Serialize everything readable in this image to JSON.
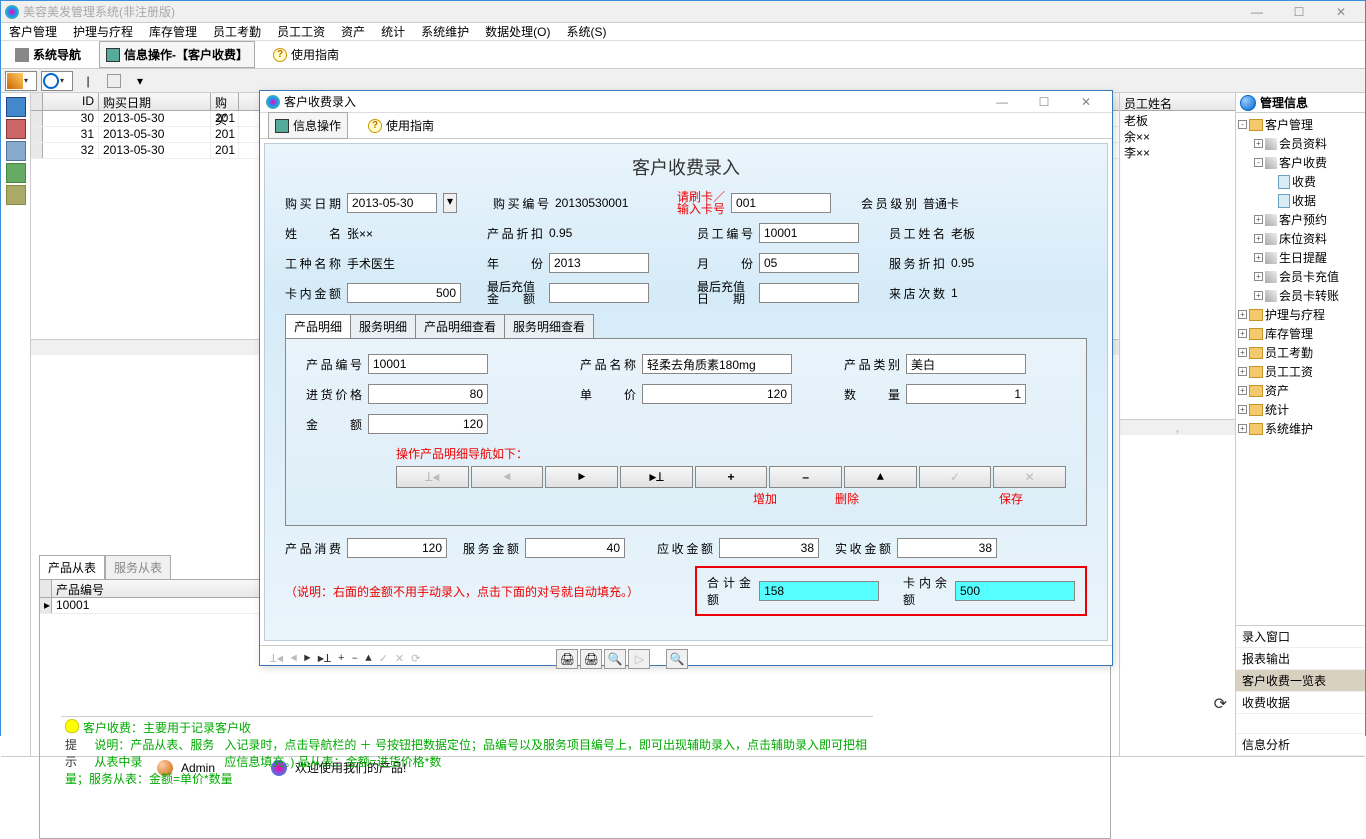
{
  "app": {
    "title": "美容美发管理系统(非注册版)"
  },
  "menu": [
    "客户管理",
    "护理与疗程",
    "库存管理",
    "员工考勤",
    "员工工资",
    "资产",
    "统计",
    "系统维护",
    "数据处理(O)",
    "系统(S)"
  ],
  "topTabs": {
    "nav": "系统导航",
    "info": "信息操作-【客户收费】",
    "guide": "使用指南"
  },
  "grid": {
    "cols": [
      "ID",
      "购买日期",
      "购买"
    ],
    "rows": [
      {
        "id": "30",
        "date": "2013-05-30",
        "t": "201"
      },
      {
        "id": "31",
        "date": "2013-05-30",
        "t": "201"
      },
      {
        "id": "32",
        "date": "2013-05-30",
        "t": "201"
      }
    ]
  },
  "subTabs": {
    "a": "产品从表",
    "b": "服务从表"
  },
  "subGrid": {
    "col": "产品编号",
    "val": "10001"
  },
  "rightList": {
    "header": "员工姓名",
    "rows": [
      "老板",
      "余××",
      "李××"
    ]
  },
  "tree": {
    "header": "管理信息",
    "root": "客户管理",
    "items": [
      "会员资料",
      "客户收费",
      "收费",
      "收据",
      "客户预约",
      "床位资料",
      "生日提醒",
      "会员卡充值",
      "会员卡转账"
    ],
    "folders": [
      "护理与疗程",
      "库存管理",
      "员工考勤",
      "员工工资",
      "资产",
      "统计",
      "系统维护"
    ],
    "bottom": [
      "录入窗口",
      "报表输出",
      "客户收费一览表",
      "收费收据",
      "信息分析"
    ]
  },
  "help": {
    "l1": "客户收费：主要用于记录客户收",
    "l2pre": "说明：产品从表、服务从表中录",
    "l2rest": "入记录时，点击导航栏的 ＋ 号按钮把数据定位；品编号以及服务项目编号上，即可出现辅助录入，点击辅助录入即可把相应信息填充。)   品从表：金额=进货价格*数",
    "l3": "量；服务从表：金额=单价*数量",
    "hint": "提示"
  },
  "status": {
    "admin": "Admin",
    "welcome": "欢迎使用我们的产品!"
  },
  "modal": {
    "title": "客户收费录入",
    "tabs": {
      "info": "信息操作",
      "guide": "使用指南"
    },
    "heading": "客户收费录入",
    "labels": {
      "buyDate": "购买日期",
      "buyNo": "购买编号",
      "swipe": "请刷卡／",
      "enterCard": "输入卡号",
      "memberLvl": "会员级别",
      "name": "姓　　名",
      "discount": "产品折扣",
      "empNo": "员工编号",
      "empName": "员工姓名",
      "jobName": "工种名称",
      "year": "年　　份",
      "month": "月　　份",
      "svcDisc": "服务折扣",
      "cardAmt": "卡内金额",
      "lastAmt": "最后充值",
      "lastAmt2": "金　　额",
      "lastDate": "最后充值",
      "lastDate2": "日　　期",
      "visits": "来店次数"
    },
    "values": {
      "buyDate": "2013-05-30",
      "buyNo": "20130530001",
      "cardNo": "001",
      "memberLvl": "普通卡",
      "name": "张××",
      "discount": "0.95",
      "empNo": "10001",
      "empName": "老板",
      "jobName": "手术医生",
      "year": "2013",
      "month": "05",
      "svcDisc": "0.95",
      "cardAmt": "500",
      "lastRecharge": "",
      "lastDate": "",
      "visits": "1"
    },
    "innerTabs": [
      "产品明细",
      "服务明细",
      "产品明细查看",
      "服务明细查看"
    ],
    "detail": {
      "labels": {
        "pno": "产品编号",
        "pname": "产品名称",
        "pcat": "产品类别",
        "cost": "进货价格",
        "price": "单　　价",
        "qty": "数　　量",
        "amt": "金　　额"
      },
      "values": {
        "pno": "10001",
        "pname": "轻柔去角质素180mg",
        "pcat": "美白",
        "cost": "80",
        "price": "120",
        "qty": "1",
        "amt": "120"
      },
      "instruction": "操作产品明细导航如下：",
      "btnLabels": {
        "add": "增加",
        "del": "删除",
        "save": "保存"
      }
    },
    "summary": {
      "labels": {
        "prodCost": "产品消费",
        "svcAmt": "服务金额",
        "receivable": "应收金额",
        "received": "实收金额",
        "total": "合计金额",
        "balance": "卡内余额"
      },
      "values": {
        "prodCost": "120",
        "svcAmt": "40",
        "receivable": "38",
        "received": "38",
        "total": "158",
        "balance": "500"
      },
      "note": "（说明：右面的金额不用手动录入，点击下面的对号就自动填充。）"
    }
  }
}
